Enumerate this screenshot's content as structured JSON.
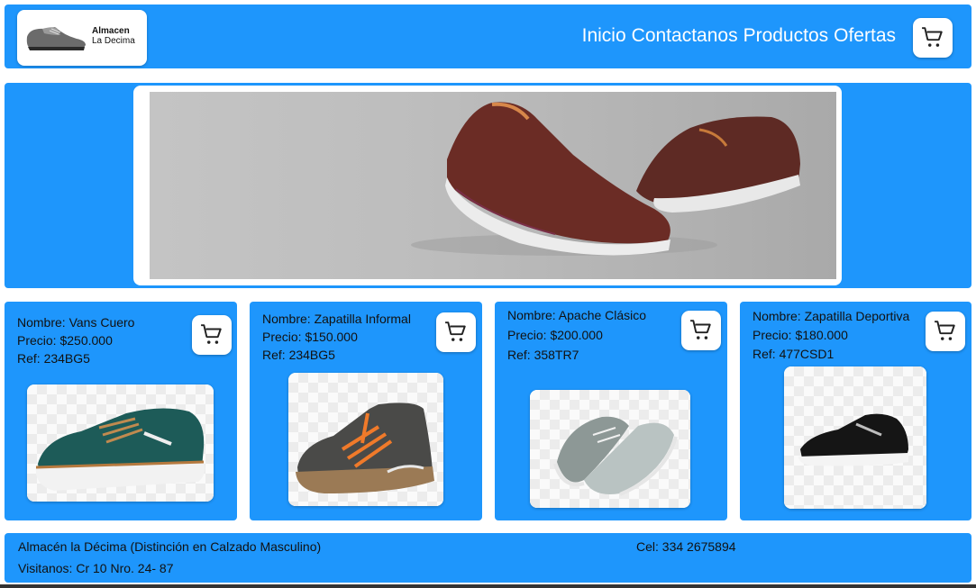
{
  "header": {
    "logo": {
      "line1": "Almacen",
      "line2": "La Decima"
    },
    "nav": [
      "Inicio",
      "Contactanos",
      "Productos",
      "Ofertas"
    ]
  },
  "products": [
    {
      "name": "Nombre: Vans Cuero",
      "price": "Precio: $250.000",
      "ref": "Ref: 234BG5"
    },
    {
      "name": "Nombre: Zapatilla Informal",
      "price": "Precio: $150.000",
      "ref": "Ref: 234BG5"
    },
    {
      "name": "Nombre: Apache Clásico",
      "price": "Precio: $200.000",
      "ref": "Ref: 358TR7"
    },
    {
      "name": "Nombre: Zapatilla Deportiva",
      "price": "Precio: $180.000",
      "ref": "Ref: 477CSD1"
    }
  ],
  "footer": {
    "store": "Almacén la Décima (Distinción en Calzado Masculino)",
    "address": "Visitanos: Cr 10 Nro. 24- 87",
    "phone": "Cel: 334 2675894"
  },
  "colors": {
    "primary": "#1e96fc",
    "card": "#ffffff",
    "text": "#111111"
  },
  "icons": [
    "shopping-cart-icon"
  ]
}
